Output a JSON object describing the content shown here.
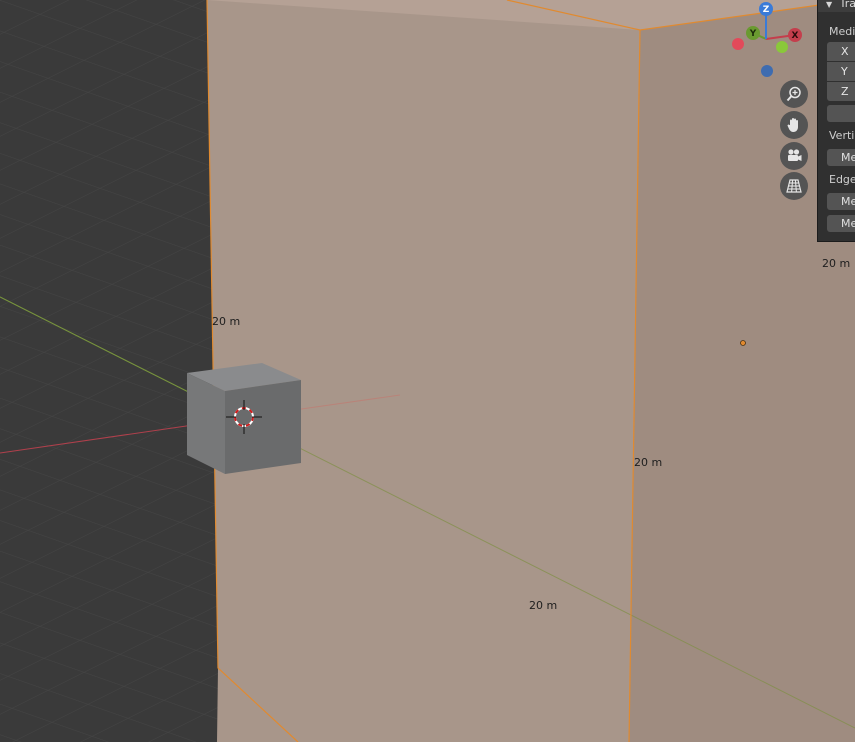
{
  "viewport": {
    "dimensions": {
      "top_left": "20 m",
      "bottom": "20 m",
      "center": "20 m",
      "right": "20 m"
    }
  },
  "gizmo": {
    "x": "X",
    "y": "Y",
    "z": "Z"
  },
  "nav_buttons": [
    "zoom-icon",
    "hand-pan-icon",
    "camera-icon",
    "grid-perspective-icon"
  ],
  "sidebar": {
    "header": "Tra",
    "median_label": "Media",
    "axes": [
      "X",
      "Y",
      "Z"
    ],
    "vertices_label": "Vertic",
    "vertex_field": "Me",
    "edges_label": "Edges",
    "edge_fields": [
      "Me",
      "Me"
    ]
  },
  "colors": {
    "background": "#3a3a3a",
    "grid": "#424242",
    "selected_face": "#a8968a",
    "selected_edge": "#e08a30",
    "axis_x": "#c43e4c",
    "axis_y": "#6a9a30",
    "axis_z": "#3a7bd8"
  }
}
